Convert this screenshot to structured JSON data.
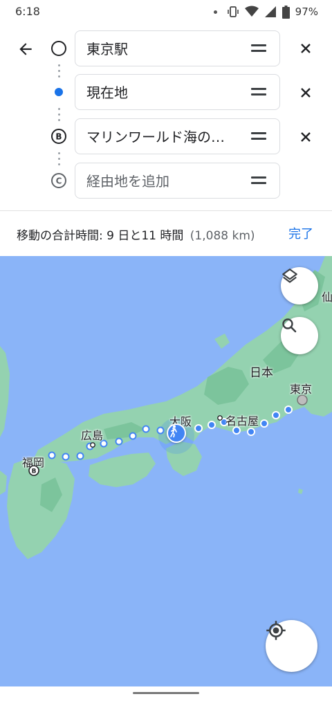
{
  "status_bar": {
    "time": "6:18",
    "battery": "97%",
    "icons": [
      "notification-dot",
      "vibrate-icon",
      "wifi-icon",
      "signal-icon",
      "battery-icon"
    ]
  },
  "route_editor": {
    "back_icon": "arrow-back-icon",
    "stops": [
      {
        "label": "東京駅",
        "marker": "circle",
        "removable": true
      },
      {
        "label": "現在地",
        "marker": "blue-dot",
        "removable": true
      },
      {
        "label": "マリンワールド海の…",
        "marker": "B",
        "removable": true
      },
      {
        "placeholder": "経由地を追加",
        "marker": "C",
        "removable": false
      }
    ],
    "drag_icon": "drag-handle-icon",
    "remove_icon": "close-icon"
  },
  "summary": {
    "text": "移動の合計時間: 9 日と11 時間",
    "distance": "(1,088 km)",
    "done_label": "完了"
  },
  "map": {
    "labels": {
      "tokyo": "東京",
      "osaka": "大阪",
      "nagoya": "名古屋",
      "hiroshima": "広島",
      "fukuoka": "福岡",
      "japan": "日本",
      "sendai_partial": "仙"
    },
    "marker_b": "B",
    "colors": {
      "water": "#8ab4f8",
      "land": "#94d2b0",
      "land_dark": "#7cc49c",
      "route_blue": "#4285f4",
      "accent": "#1a73e8"
    },
    "buttons": {
      "layers_icon": "layers-icon",
      "search_icon": "search-icon",
      "location_icon": "my-location-icon",
      "walking_icon": "walking-icon"
    }
  }
}
